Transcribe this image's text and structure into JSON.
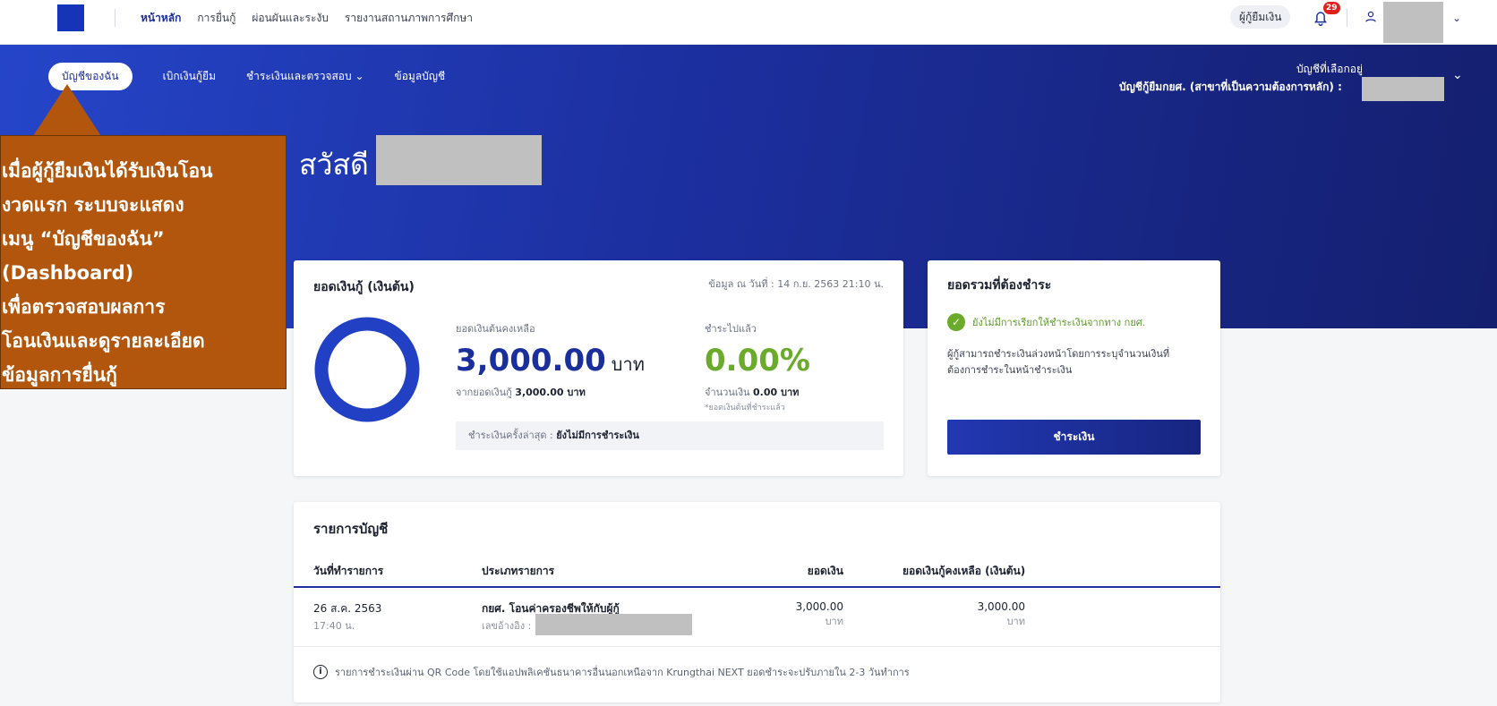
{
  "topnav": {
    "items": [
      "หน้าหลัก",
      "การยื่นกู้",
      "ผ่อนผันและระงับ",
      "รายงานสถานภาพการศึกษา"
    ],
    "active_index": 0
  },
  "header_right": {
    "role_label": "ผู้กู้ยืมเงิน",
    "notification_count": "29"
  },
  "subnav": {
    "items": [
      "บัญชีของฉัน",
      "เบิกเงินกู้ยืม",
      "ชำระเงินและตรวจสอบ ⌄",
      "ข้อมูลบัญชี"
    ]
  },
  "account": {
    "selected_label": "บัญชีที่เลือกอยู่",
    "line": "บัญชีกู้ยืมกยศ. (สาขาที่เป็นความต้องการหลัก) :"
  },
  "greeting": "สวัสดี",
  "loan_card": {
    "title": "ยอดเงินกู้ (เงินต้น)",
    "as_of": "ข้อมูล ณ วันที่ : 14 ก.ย. 2563 21:10 น.",
    "remaining_label": "ยอดเงินต้นคงเหลือ",
    "remaining_amount": "3,000.00",
    "unit": "บาท",
    "from_prefix": "จากยอดเงินกู้",
    "from_amount": "3,000.00 บาท",
    "paid_label": "ชำระไปแล้ว",
    "paid_percent": "0.00%",
    "paid_amount_prefix": "จำนวนเงิน",
    "paid_amount": "0.00 บาท",
    "paid_note": "*ยอดเงินต้นที่ชำระแล้ว",
    "last_payment_label": "ชำระเงินครั้งล่าสุด :",
    "last_payment_value": "ยังไม่มีการชำระเงิน",
    "donut_color": "#2140c4",
    "remaining_fraction": 1.0
  },
  "due_card": {
    "title": "ยอดรวมที่ต้องชำระ",
    "status": "ยังไม่มีการเรียกให้ชำระเงินจากทาง กยศ.",
    "description": "ผู้กู้สามารถชำระเงินล่วงหน้าโดยการระบุจำนวนเงินที่ต้องการชำระในหน้าชำระเงิน",
    "button": "ชำระเงิน"
  },
  "transactions": {
    "title": "รายการบัญชี",
    "headers": [
      "วันที่ทำรายการ",
      "ประเภทรายการ",
      "ยอดเงิน",
      "ยอดเงินกู้คงเหลือ (เงินต้น)"
    ],
    "rows": [
      {
        "date": "26 ส.ค. 2563",
        "time": "17:40 น.",
        "type": "กยศ. โอนค่าครองชีพให้กับผู้กู้",
        "ref_label": "เลขอ้างอิง :",
        "amount": "3,000.00",
        "amount_unit": "บาท",
        "balance": "3,000.00",
        "balance_unit": "บาท"
      }
    ],
    "note": "รายการชำระเงินผ่าน QR Code โดยใช้แอปพลิเคชันธนาคารอื่นนอกเหนือจาก Krungthai NEXT ยอดชำระจะปรับภายใน 2-3 วันทำการ"
  },
  "callout": {
    "lines": [
      "เมื่อผู้กู้ยืมเงินได้รับเงินโอน",
      "งวดแรก ระบบจะแสดง",
      "เมนู “บัญชีของฉัน”",
      "(Dashboard)",
      "เพื่อตรวจสอบผลการ",
      "โอนเงินและดูรายละเอียด",
      "ข้อมูลการยื่นกู้"
    ]
  }
}
